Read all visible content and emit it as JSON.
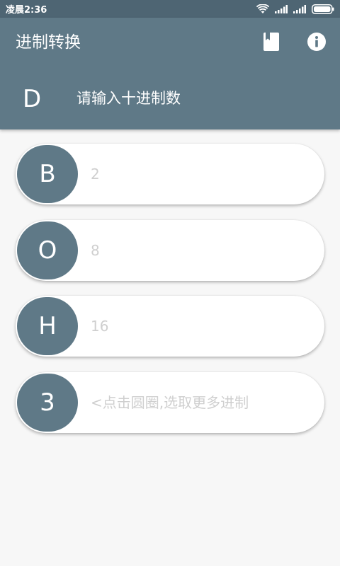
{
  "status_bar": {
    "time": "凌晨2:36",
    "icons": [
      "wifi-icon",
      "signal-icon",
      "signal-icon",
      "battery-icon"
    ]
  },
  "app_bar": {
    "title": "进制转换",
    "actions": [
      "book-icon",
      "info-icon"
    ]
  },
  "input_section": {
    "base_letter": "D",
    "placeholder": "请输入十进制数"
  },
  "conversions": [
    {
      "letter": "B",
      "placeholder": "2"
    },
    {
      "letter": "O",
      "placeholder": "8"
    },
    {
      "letter": "H",
      "placeholder": "16"
    },
    {
      "letter": "3",
      "placeholder": "<点击圆圈,选取更多进制"
    }
  ],
  "colors": {
    "primary": "#5f7987",
    "status_bar": "#4e6573",
    "background": "#f7f7f7"
  }
}
